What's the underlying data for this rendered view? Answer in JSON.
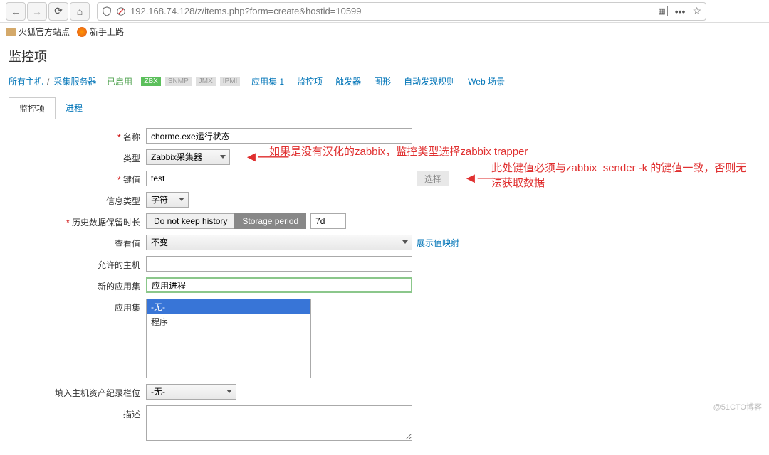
{
  "browser": {
    "url": "192.168.74.128/z/items.php?form=create&hostid=10599",
    "bookmarks": {
      "folder": "火狐官方站点",
      "getting_started": "新手上路"
    }
  },
  "page": {
    "title": "监控项"
  },
  "breadcrumb": {
    "all_hosts": "所有主机",
    "host": "采集服务器",
    "enabled": "已启用",
    "zbx": "ZBX",
    "snmp": "SNMP",
    "jmx": "JMX",
    "ipmi": "IPMI",
    "apps": "应用集 1",
    "items": "监控项",
    "triggers": "触发器",
    "graphs": "图形",
    "discovery": "自动发现规则",
    "web": "Web 场景"
  },
  "tabs": {
    "item": "监控项",
    "process": "进程"
  },
  "form": {
    "name_label": "名称",
    "name_value": "chorme.exe运行状态",
    "type_label": "类型",
    "type_value": "Zabbix采集器",
    "key_label": "键值",
    "key_value": "test",
    "key_select_btn": "选择",
    "info_type_label": "信息类型",
    "info_type_value": "字符",
    "history_label": "历史数据保留时长",
    "history_btn1": "Do not keep history",
    "history_btn2": "Storage period",
    "history_value": "7d",
    "lookup_label": "查看值",
    "lookup_value": "不变",
    "lookup_link": "展示值映射",
    "allowed_hosts_label": "允许的主机",
    "allowed_hosts_value": "",
    "new_app_label": "新的应用集",
    "new_app_value": "应用进程",
    "app_label": "应用集",
    "app_options": [
      "-无-",
      "程序"
    ],
    "inventory_label": "填入主机资产纪录栏位",
    "inventory_value": "-无-",
    "desc_label": "描述",
    "desc_value": ""
  },
  "annotations": {
    "type_note": "如果是没有汉化的zabbix，监控类型选择zabbix trapper",
    "key_note": "此处键值必须与zabbix_sender -k 的键值一致，否则无法获取数据"
  },
  "watermark": "@51CTO博客"
}
